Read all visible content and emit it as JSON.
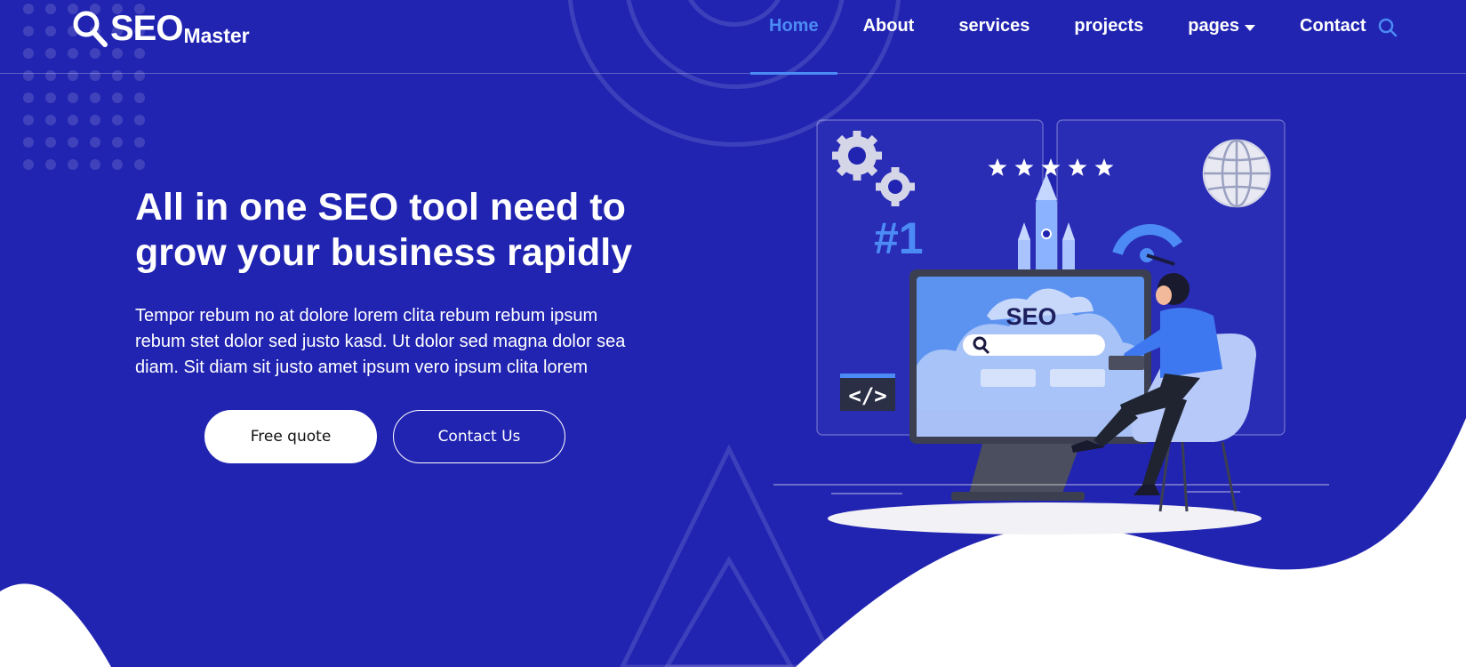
{
  "brand": {
    "name_main": "SEO",
    "name_sub": "Master",
    "icon": "magnifier-icon"
  },
  "nav": {
    "items": [
      {
        "label": "Home",
        "active": true
      },
      {
        "label": "About",
        "active": false
      },
      {
        "label": "services",
        "active": false
      },
      {
        "label": "projects",
        "active": false
      },
      {
        "label": "pages",
        "active": false,
        "dropdown": true
      },
      {
        "label": "Contact",
        "active": false
      }
    ],
    "search_icon": "search-icon"
  },
  "hero": {
    "title": "All in one SEO tool need to grow your business rapidly",
    "text": "Tempor rebum no at dolore lorem clita rebum rebum ipsum rebum stet dolor sed justo kasd. Ut dolor sed magna dolor sea diam. Sit diam sit justo amet ipsum vero ipsum clita lorem",
    "primary_button": "Free quote",
    "secondary_button": "Contact Us"
  },
  "illustration": {
    "rank_badge": "#1",
    "screen_label": "SEO",
    "code_tag": "</>",
    "star_count": 5
  },
  "colors": {
    "background": "#2124b1",
    "accent": "#4c8bf5",
    "text": "#ffffff"
  }
}
